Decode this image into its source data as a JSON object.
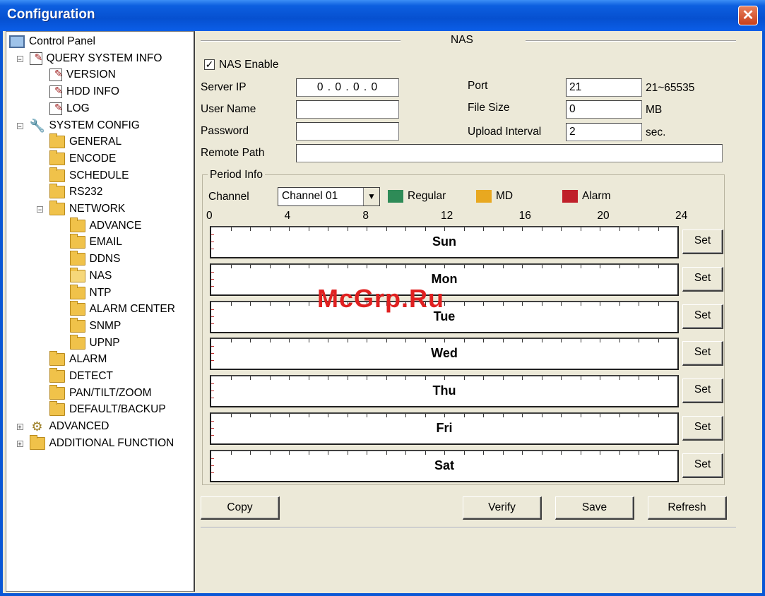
{
  "window": {
    "title": "Configuration"
  },
  "tree": [
    {
      "label": "Control Panel",
      "icon": "pc"
    },
    {
      "label": "QUERY SYSTEM INFO",
      "icon": "doc"
    },
    {
      "label": "VERSION",
      "icon": "doc"
    },
    {
      "label": "HDD INFO",
      "icon": "doc"
    },
    {
      "label": "LOG",
      "icon": "doc"
    },
    {
      "label": "SYSTEM CONFIG",
      "icon": "tools"
    },
    {
      "label": "GENERAL",
      "icon": "folder"
    },
    {
      "label": "ENCODE",
      "icon": "folder"
    },
    {
      "label": "SCHEDULE",
      "icon": "folder"
    },
    {
      "label": "RS232",
      "icon": "folder"
    },
    {
      "label": "NETWORK",
      "icon": "folder"
    },
    {
      "label": "ADVANCE",
      "icon": "folder"
    },
    {
      "label": "EMAIL",
      "icon": "folder"
    },
    {
      "label": "DDNS",
      "icon": "folder"
    },
    {
      "label": "NAS",
      "icon": "folder-open"
    },
    {
      "label": "NTP",
      "icon": "folder"
    },
    {
      "label": "ALARM CENTER",
      "icon": "folder"
    },
    {
      "label": "SNMP",
      "icon": "folder"
    },
    {
      "label": "UPNP",
      "icon": "folder"
    },
    {
      "label": "ALARM",
      "icon": "folder"
    },
    {
      "label": "DETECT",
      "icon": "folder"
    },
    {
      "label": "PAN/TILT/ZOOM",
      "icon": "folder"
    },
    {
      "label": "DEFAULT/BACKUP",
      "icon": "folder"
    },
    {
      "label": "ADVANCED",
      "icon": "gears"
    },
    {
      "label": "ADDITIONAL FUNCTION",
      "icon": "folder"
    }
  ],
  "panel": {
    "title": "NAS",
    "nas_enable": {
      "label": "NAS Enable",
      "checked": true
    },
    "server_ip": {
      "label": "Server IP",
      "value": "0 . 0 . 0 . 0"
    },
    "user_name": {
      "label": "User Name",
      "value": ""
    },
    "password": {
      "label": "Password",
      "value": ""
    },
    "remote_path": {
      "label": "Remote Path",
      "value": ""
    },
    "port": {
      "label": "Port",
      "value": "21",
      "hint": "21~65535"
    },
    "file_size": {
      "label": "File Size",
      "value": "0",
      "unit": "MB"
    },
    "upload_interval": {
      "label": "Upload Interval",
      "value": "2",
      "unit": "sec."
    }
  },
  "period": {
    "title": "Period Info",
    "channel_label": "Channel",
    "channel_value": "Channel 01",
    "legend": [
      {
        "label": "Regular",
        "color": "#2e8b57"
      },
      {
        "label": "MD",
        "color": "#e8a820"
      },
      {
        "label": "Alarm",
        "color": "#c0202a"
      }
    ],
    "hours": [
      "0",
      "4",
      "8",
      "12",
      "16",
      "20",
      "24"
    ],
    "days": [
      "Sun",
      "Mon",
      "Tue",
      "Wed",
      "Thu",
      "Fri",
      "Sat"
    ],
    "set_label": "Set"
  },
  "buttons": {
    "copy": "Copy",
    "verify": "Verify",
    "save": "Save",
    "refresh": "Refresh"
  },
  "watermark": "McGrp.Ru"
}
